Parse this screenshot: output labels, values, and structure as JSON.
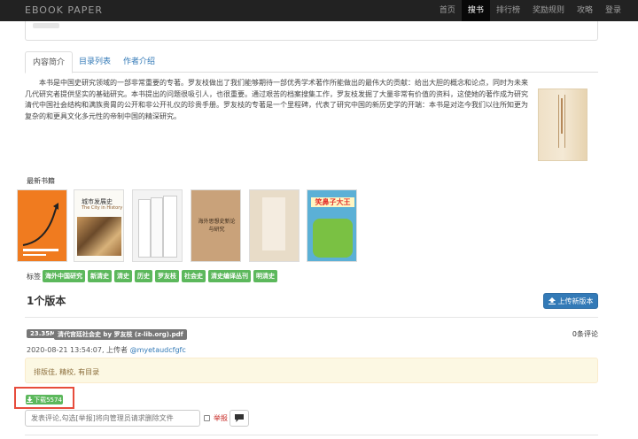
{
  "navbar": {
    "brand": "EBOOK   PAPER",
    "items": [
      {
        "label": "首页"
      },
      {
        "label": "搜书"
      },
      {
        "label": "排行榜"
      },
      {
        "label": "奖励规则"
      },
      {
        "label": "攻略"
      },
      {
        "label": "登录"
      }
    ],
    "active_index": 1
  },
  "tabs": [
    {
      "label": "内容简介"
    },
    {
      "label": "目录列表"
    },
    {
      "label": "作者介绍"
    }
  ],
  "description": "本书是中国史研究领域的一部非常重要的专著。罗友枝做出了我们能够期待一部优秀学术著作所能做出的最伟大的贡献：给出大胆的概念和论点，同时为未来几代研究者提供坚实的基础研究。本书提出的问题很吸引人，也很重要。通过艰苦的档案搜集工作，罗友枝发掘了大量非常有价值的资料，这使她的著作成为研究清代中国社会结构和满族贵胄的公开和非公开礼仪的珍贵手册。罗友枝的专著是一个里程碑，代表了研究中国的新历史学的开端：本书是对迄今我们以往所知更为复杂的和更具文化多元性的帝制中国的精深研究。",
  "latest_books": {
    "label": "最新书籍",
    "books": [
      {
        "name": "book-cover-orange"
      },
      {
        "name": "book-cover-city-history",
        "title": "城市发展史",
        "subtitle": "The City in History"
      },
      {
        "name": "book-cover-white-set"
      },
      {
        "name": "book-cover-thinking-science",
        "title": "海外思想史新论与研究"
      },
      {
        "name": "book-cover-tan"
      },
      {
        "name": "book-cover-kids",
        "title": "笑鼻子大王"
      }
    ]
  },
  "tags": {
    "label": "标签",
    "items": [
      "海外中国研究",
      "新清史",
      "清史",
      "历史",
      "罗友枝",
      "社会史",
      "清史编译丛刊",
      "明清史"
    ]
  },
  "versions": {
    "title": "1个版本",
    "upload_button": "上传新版本",
    "items": [
      {
        "size": "23.35M",
        "filename": "清代宫廷社会史 by 罗友枝 (z-lib.org).pdf",
        "comments": "0条评论",
        "upload_prefix": "2020-08-21 13:54:07, 上传者",
        "uploader": "@myetaudcfgfc",
        "note": "排版佳, 精校, 有目录",
        "download_label": "下载5574"
      }
    ]
  },
  "comment": {
    "placeholder": "发表评论,勾选[举报]将向管理员请求删除文件",
    "report_label": "举报"
  },
  "colors": {
    "navbar": "#222222",
    "link": "#337ab7",
    "tag": "#5cb85c",
    "highlight": "#e74c3c",
    "note_bg": "#fcf8e3"
  }
}
